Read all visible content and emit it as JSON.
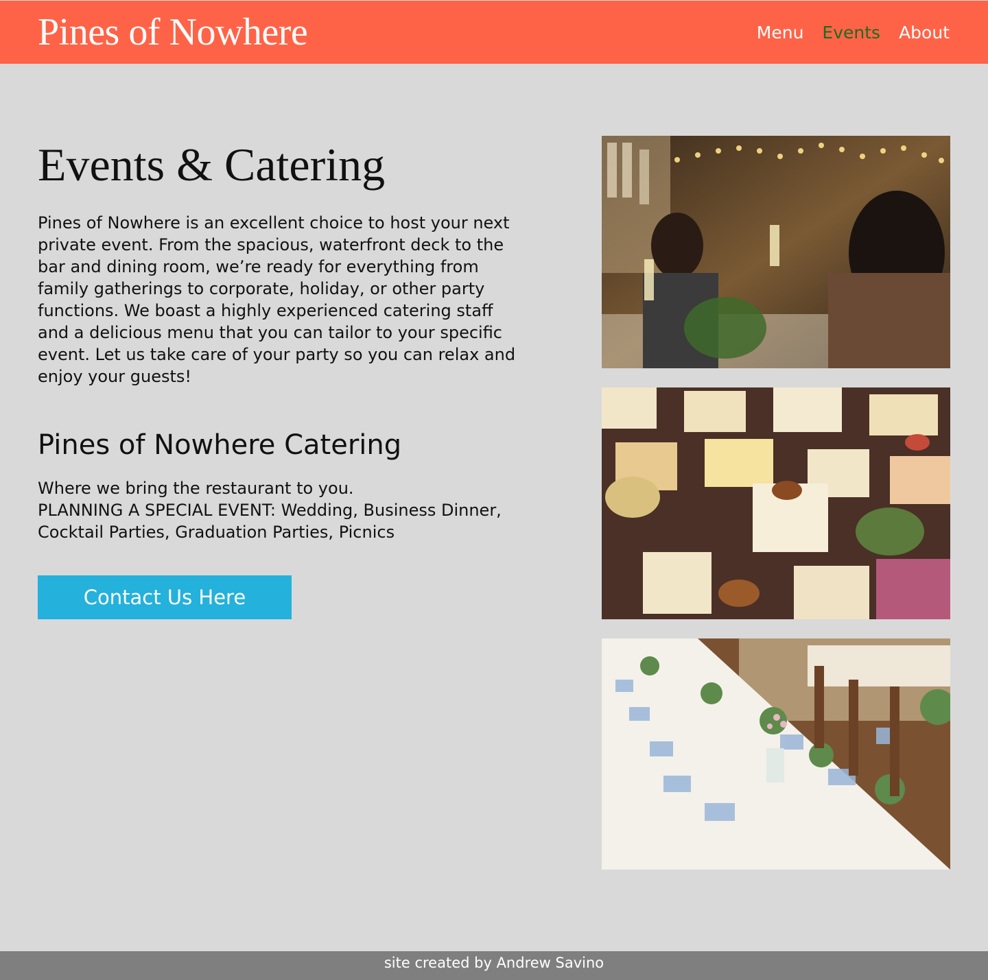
{
  "header": {
    "brand": "Pines of Nowhere",
    "nav": [
      {
        "label": "Menu",
        "active": false
      },
      {
        "label": "Events",
        "active": true
      },
      {
        "label": "About",
        "active": false
      }
    ]
  },
  "main": {
    "title": "Events & Catering",
    "intro": "Pines of Nowhere is an excellent choice to host your next private event. From the spacious, waterfront deck to the bar and dining room, we’re ready for everything from family gatherings to corporate, holiday, or other party functions. We boast a highly experienced catering staff and a delicious menu that you can tailor to your specific event. Let us take care of your party so you can relax and enjoy your guests!",
    "subtitle": "Pines of Nowhere Catering",
    "tagline_line1": "Where we bring the restaurant to you.",
    "tagline_line2": "PLANNING A SPECIAL EVENT: Wedding, Business Dinner, Cocktail Parties, Graduation Parties, Picnics",
    "cta_label": "Contact Us Here"
  },
  "photos": [
    {
      "name": "guests-toasting-photo"
    },
    {
      "name": "catering-appetizers-photo"
    },
    {
      "name": "banquet-table-photo"
    }
  ],
  "footer": {
    "credit": "site created by Andrew Savino"
  },
  "colors": {
    "header_bg": "#ff6347",
    "nav_active": "#1f6b1f",
    "cta_bg": "#24b1db",
    "page_bg": "#d9d9d9",
    "footer_bg": "#7f7f7f"
  }
}
